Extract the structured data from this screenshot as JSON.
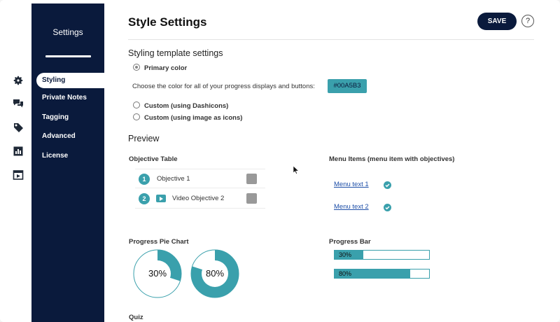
{
  "sidebar": {
    "title": "Settings",
    "items": [
      {
        "label": "Styling",
        "active": true
      },
      {
        "label": "Private Notes",
        "active": false
      },
      {
        "label": "Tagging",
        "active": false
      },
      {
        "label": "Advanced",
        "active": false
      },
      {
        "label": "License",
        "active": false
      }
    ]
  },
  "rail_icons": [
    "gear-icon",
    "comments-icon",
    "tag-icon",
    "chart-icon",
    "video-icon"
  ],
  "header": {
    "title": "Style Settings",
    "save_label": "SAVE",
    "help_label": "?"
  },
  "styling": {
    "section_title": "Styling template settings",
    "options": [
      {
        "label": "Primary color",
        "checked": true
      },
      {
        "label": "Custom (using Dashicons)",
        "checked": false
      },
      {
        "label": "Custom (using image as icons)",
        "checked": false
      }
    ],
    "color_prompt": "Choose the color for all of your progress displays and buttons:",
    "color_value": "#00A5B3"
  },
  "preview": {
    "title": "Preview",
    "objective_table": {
      "title": "Objective Table",
      "rows": [
        {
          "num": "1",
          "label": "Objective 1",
          "video": false
        },
        {
          "num": "2",
          "label": "Video Objective 2",
          "video": true
        }
      ]
    },
    "menu_items": {
      "title": "Menu Items (menu item with objectives)",
      "links": [
        "Menu text 1",
        "Menu text 2"
      ]
    },
    "pie_chart": {
      "title": "Progress Pie Chart",
      "charts": [
        {
          "label": "30%",
          "value": 0.3
        },
        {
          "label": "80%",
          "value": 0.8
        }
      ]
    },
    "progress_bar": {
      "title": "Progress Bar",
      "bars": [
        {
          "label": "30%",
          "value": 0.3
        },
        {
          "label": "80%",
          "value": 0.8
        }
      ]
    },
    "quiz_title": "Quiz"
  },
  "colors": {
    "sidebar_bg": "#0a1a3c",
    "accent": "#3aa0ac",
    "link": "#1e4fa8"
  }
}
